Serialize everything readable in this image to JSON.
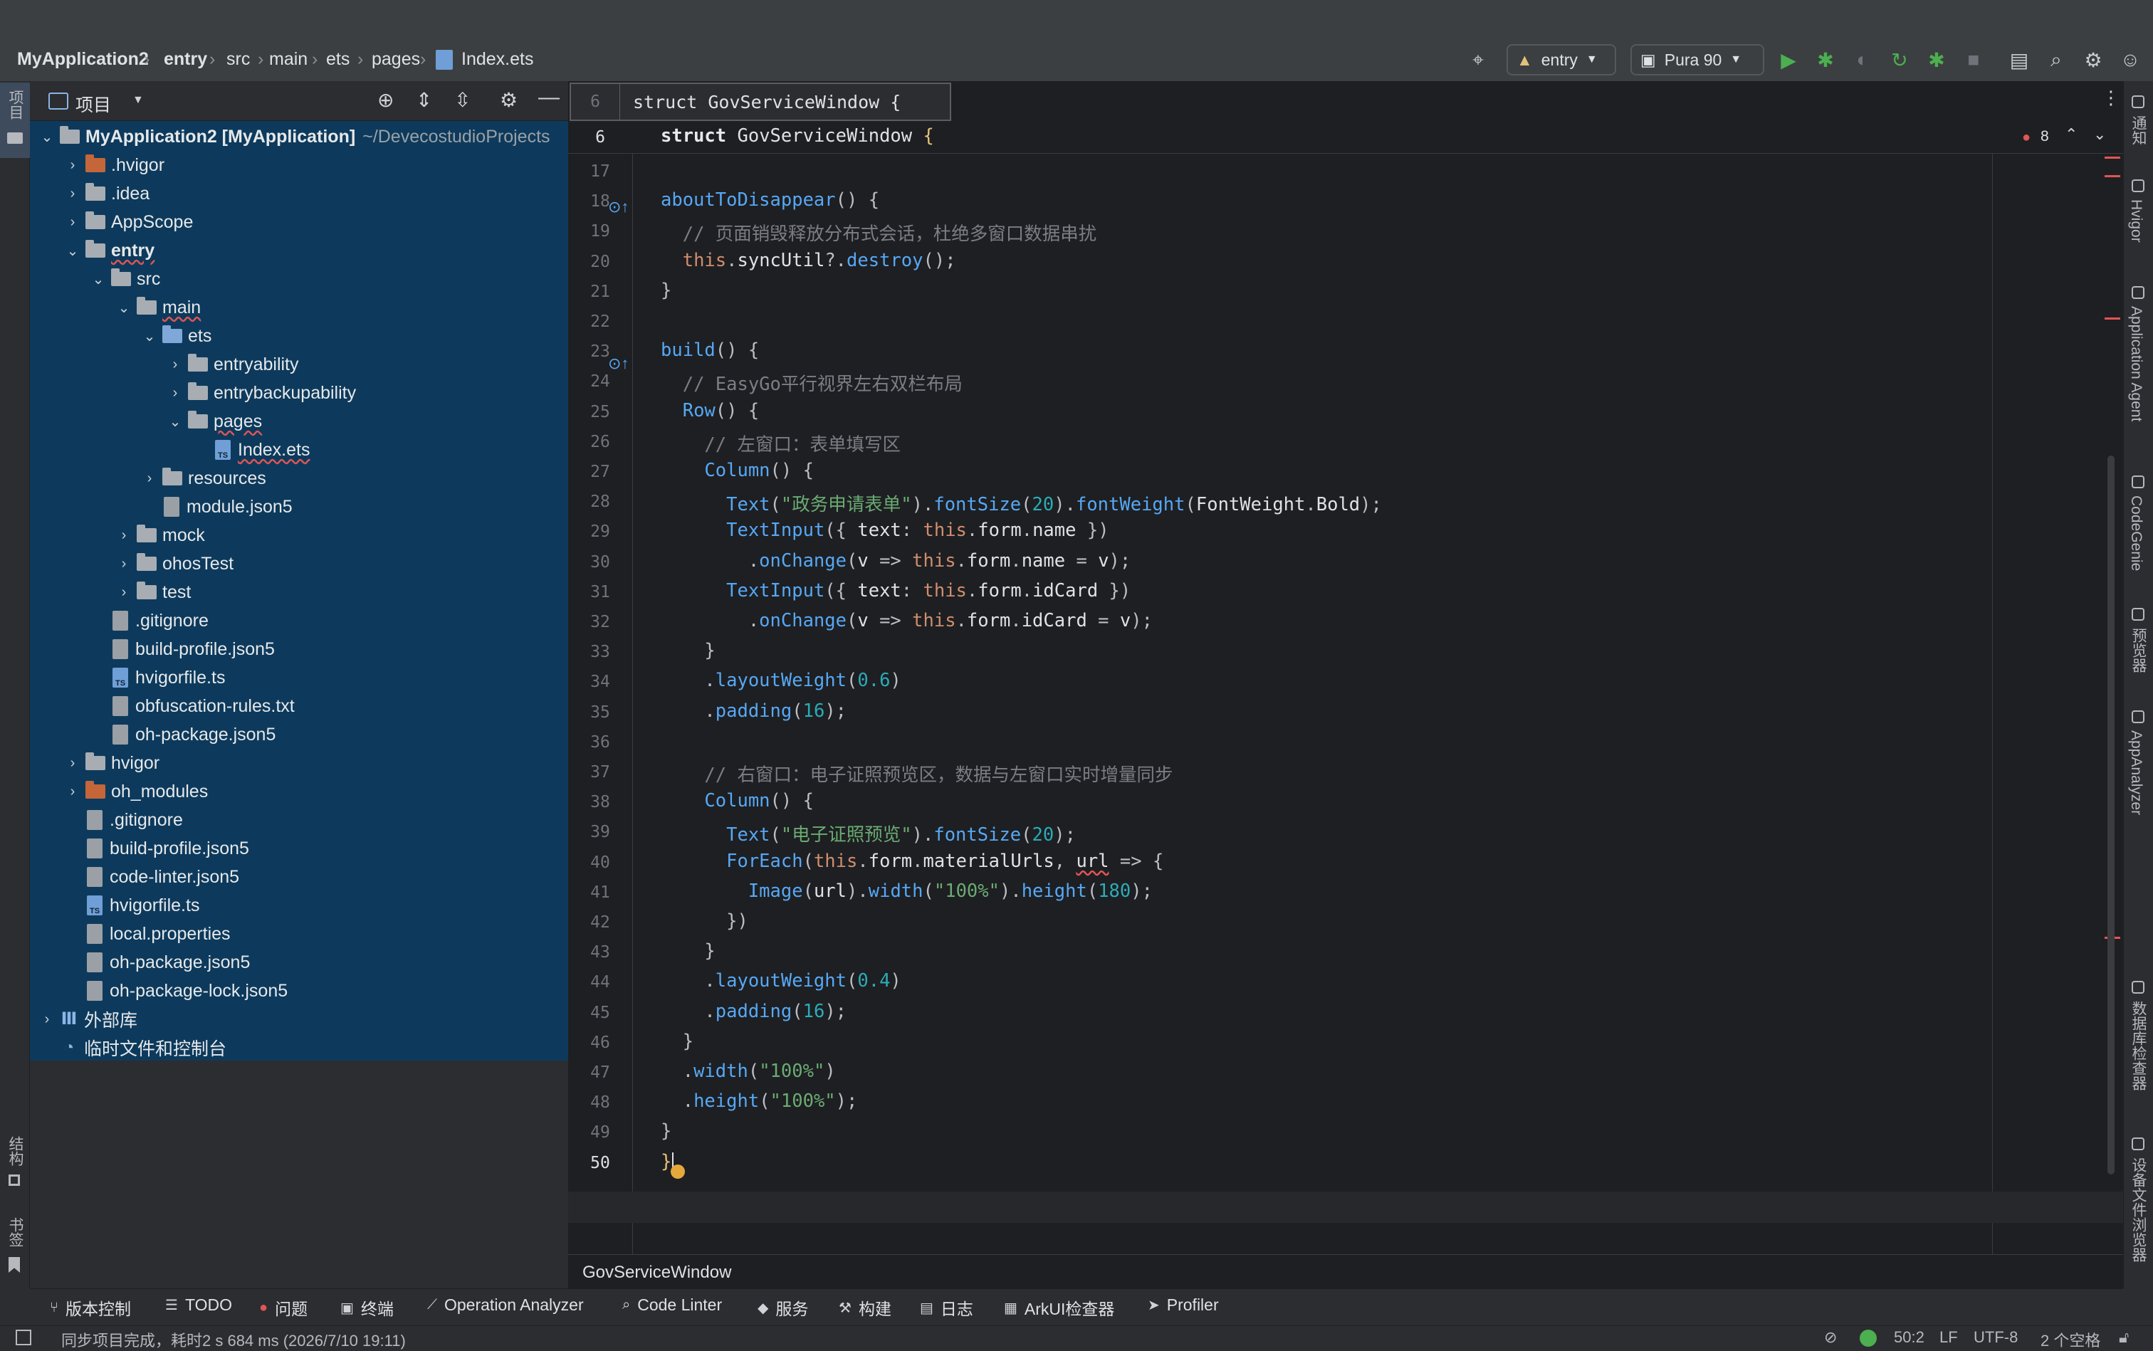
{
  "breadcrumbs": [
    "MyApplication2",
    "entry",
    "src",
    "main",
    "ets",
    "pages",
    "Index.ets"
  ],
  "toolbar": {
    "module_select": "entry",
    "device_select": "Pura 90"
  },
  "left_strip": {
    "project": "项目",
    "structure": "结构",
    "bookmarks": "书签"
  },
  "right_strip": [
    "通知",
    "Hvigor",
    "Application Agent",
    "CodeGenie",
    "预览器",
    "AppAnalyzer",
    "数据库检查器",
    "设备文件浏览器"
  ],
  "project_panel": {
    "title": "项目"
  },
  "tree": [
    {
      "label": "MyApplication2 [MyApplication]",
      "extra": "~/DevecostudioProjects",
      "depth": 0,
      "open": true,
      "type": "module"
    },
    {
      "label": ".hvigor",
      "depth": 1,
      "open": false,
      "type": "folder-orange"
    },
    {
      "label": ".idea",
      "depth": 1,
      "open": false,
      "type": "folder"
    },
    {
      "label": "AppScope",
      "depth": 1,
      "open": false,
      "type": "folder"
    },
    {
      "label": "entry",
      "depth": 1,
      "open": true,
      "type": "module"
    },
    {
      "label": "src",
      "depth": 2,
      "open": true,
      "type": "folder"
    },
    {
      "label": "main",
      "depth": 3,
      "open": true,
      "type": "folder"
    },
    {
      "label": "ets",
      "depth": 4,
      "open": true,
      "type": "folder-blue"
    },
    {
      "label": "entryability",
      "depth": 5,
      "open": false,
      "type": "folder"
    },
    {
      "label": "entrybackupability",
      "depth": 5,
      "open": false,
      "type": "folder"
    },
    {
      "label": "pages",
      "depth": 5,
      "open": true,
      "type": "folder"
    },
    {
      "label": "Index.ets",
      "depth": 6,
      "type": "file-ts"
    },
    {
      "label": "resources",
      "depth": 4,
      "open": false,
      "type": "folder"
    },
    {
      "label": "module.json5",
      "depth": 4,
      "type": "file"
    },
    {
      "label": "mock",
      "depth": 3,
      "open": false,
      "type": "folder"
    },
    {
      "label": "ohosTest",
      "depth": 3,
      "open": false,
      "type": "folder"
    },
    {
      "label": "test",
      "depth": 3,
      "open": false,
      "type": "folder"
    },
    {
      "label": ".gitignore",
      "depth": 2,
      "type": "file"
    },
    {
      "label": "build-profile.json5",
      "depth": 2,
      "type": "file"
    },
    {
      "label": "hvigorfile.ts",
      "depth": 2,
      "type": "file-ts"
    },
    {
      "label": "obfuscation-rules.txt",
      "depth": 2,
      "type": "file"
    },
    {
      "label": "oh-package.json5",
      "depth": 2,
      "type": "file"
    },
    {
      "label": "hvigor",
      "depth": 1,
      "open": false,
      "type": "folder"
    },
    {
      "label": "oh_modules",
      "depth": 1,
      "open": false,
      "type": "folder-orange"
    },
    {
      "label": ".gitignore",
      "depth": 1,
      "type": "file"
    },
    {
      "label": "build-profile.json5",
      "depth": 1,
      "type": "file"
    },
    {
      "label": "code-linter.json5",
      "depth": 1,
      "type": "file"
    },
    {
      "label": "hvigorfile.ts",
      "depth": 1,
      "type": "file-ts"
    },
    {
      "label": "local.properties",
      "depth": 1,
      "type": "file"
    },
    {
      "label": "oh-package.json5",
      "depth": 1,
      "type": "file"
    },
    {
      "label": "oh-package-lock.json5",
      "depth": 1,
      "type": "file"
    },
    {
      "label": "外部库",
      "depth": 0,
      "open": false,
      "type": "lib"
    },
    {
      "label": "临时文件和控制台",
      "depth": 0,
      "type": "scratch"
    }
  ],
  "editor": {
    "popup_line": "6",
    "popup_code": "struct GovServiceWindow {",
    "sticky_line": "6",
    "sticky_kw": "struct",
    "sticky_name": "GovServiceWindow",
    "error_count": "8",
    "breadcrumb": "GovServiceWindow",
    "lines": [
      {
        "n": "17",
        "html": ""
      },
      {
        "n": "18",
        "html": "<span class=\"f\">aboutToDisappear</span>() {"
      },
      {
        "n": "19",
        "html": "  <span class=\"c\">// 页面销毁释放分布式会话，杜绝多窗口数据串扰</span>"
      },
      {
        "n": "20",
        "html": "  <span class=\"k\">this</span>.<span class=\"pl\">syncUtil</span>?.<span class=\"f\">destroy</span>();"
      },
      {
        "n": "21",
        "html": "}"
      },
      {
        "n": "22",
        "html": ""
      },
      {
        "n": "23",
        "html": "<span class=\"f\">build</span>() {"
      },
      {
        "n": "24",
        "html": "  <span class=\"c\">// EasyGo平行视界左右双栏布局</span>"
      },
      {
        "n": "25",
        "html": "  <span class=\"f\">Row</span>() {"
      },
      {
        "n": "26",
        "html": "    <span class=\"c\">// 左窗口：表单填写区</span>"
      },
      {
        "n": "27",
        "html": "    <span class=\"f\">Column</span>() {"
      },
      {
        "n": "28",
        "html": "      <span class=\"f\">Text</span>(<span class=\"s\">\"政务申请表单\"</span>).<span class=\"f\">fontSize</span>(<span class=\"n\">20</span>).<span class=\"f\">fontWeight</span>(<span class=\"pl\">FontWeight</span>.<span class=\"pl\">Bold</span>);"
      },
      {
        "n": "29",
        "html": "      <span class=\"f\">TextInput</span>({ <span class=\"pl\">text</span>: <span class=\"k\">this</span>.<span class=\"pl\">form</span>.<span class=\"pl\">name</span> })"
      },
      {
        "n": "30",
        "html": "        .<span class=\"f\">onChange</span>(<span class=\"pl\">v</span> => <span class=\"k\">this</span>.<span class=\"pl\">form</span>.<span class=\"pl\">name</span> = <span class=\"pl\">v</span>);"
      },
      {
        "n": "31",
        "html": "      <span class=\"f\">TextInput</span>({ <span class=\"pl\">text</span>: <span class=\"k\">this</span>.<span class=\"pl\">form</span>.<span class=\"pl\">idCard</span> })"
      },
      {
        "n": "32",
        "html": "        .<span class=\"f\">onChange</span>(<span class=\"pl\">v</span> => <span class=\"k\">this</span>.<span class=\"pl\">form</span>.<span class=\"pl\">idCard</span> = <span class=\"pl\">v</span>);"
      },
      {
        "n": "33",
        "html": "    }"
      },
      {
        "n": "34",
        "html": "    .<span class=\"f\">layoutWeight</span>(<span class=\"n\">0.6</span>)"
      },
      {
        "n": "35",
        "html": "    .<span class=\"f\">padding</span>(<span class=\"n\">16</span>);"
      },
      {
        "n": "36",
        "html": ""
      },
      {
        "n": "37",
        "html": "    <span class=\"c\">// 右窗口：电子证照预览区，数据与左窗口实时增量同步</span>"
      },
      {
        "n": "38",
        "html": "    <span class=\"f\">Column</span>() {"
      },
      {
        "n": "39",
        "html": "      <span class=\"f\">Text</span>(<span class=\"s\">\"电子证照预览\"</span>).<span class=\"f\">fontSize</span>(<span class=\"n\">20</span>);"
      },
      {
        "n": "40",
        "html": "      <span class=\"f\">ForEach</span>(<span class=\"k\">this</span>.<span class=\"pl\">form</span>.<span class=\"pl\">materialUrls</span>, <span class=\"pl wavy\">url</span> => {"
      },
      {
        "n": "41",
        "html": "        <span class=\"f\">Image</span>(<span class=\"pl\">url</span>).<span class=\"f\">width</span>(<span class=\"s\">\"100%\"</span>).<span class=\"f\">height</span>(<span class=\"n\">180</span>);"
      },
      {
        "n": "42",
        "html": "      })"
      },
      {
        "n": "43",
        "html": "    }"
      },
      {
        "n": "44",
        "html": "    .<span class=\"f\">layoutWeight</span>(<span class=\"n\">0.4</span>)"
      },
      {
        "n": "45",
        "html": "    .<span class=\"f\">padding</span>(<span class=\"n\">16</span>);"
      },
      {
        "n": "46",
        "html": "  }"
      },
      {
        "n": "47",
        "html": "  .<span class=\"f\">width</span>(<span class=\"s\">\"100%\"</span>)"
      },
      {
        "n": "48",
        "html": "  .<span class=\"f\">height</span>(<span class=\"s\">\"100%\"</span>);"
      },
      {
        "n": "49",
        "html": "}"
      },
      {
        "n": "50",
        "html": "<span class=\"y\">}</span>"
      }
    ]
  },
  "bottom_tabs": [
    "版本控制",
    "TODO",
    "问题",
    "终端",
    "Operation Analyzer",
    "Code Linter",
    "服务",
    "构建",
    "日志",
    "ArkUI检查器",
    "Profiler"
  ],
  "status": {
    "message": "同步项目完成，耗时2 s 684 ms (2026/7/10 19:11)",
    "position": "50:2",
    "line_sep": "LF",
    "encoding": "UTF-8",
    "indent": "2 个空格"
  },
  "colors": {
    "tree_bg": "#0d3a5c",
    "editor_bg": "#1e1f22",
    "panel_bg": "#2b2d30",
    "accent_green": "#4caf50"
  }
}
